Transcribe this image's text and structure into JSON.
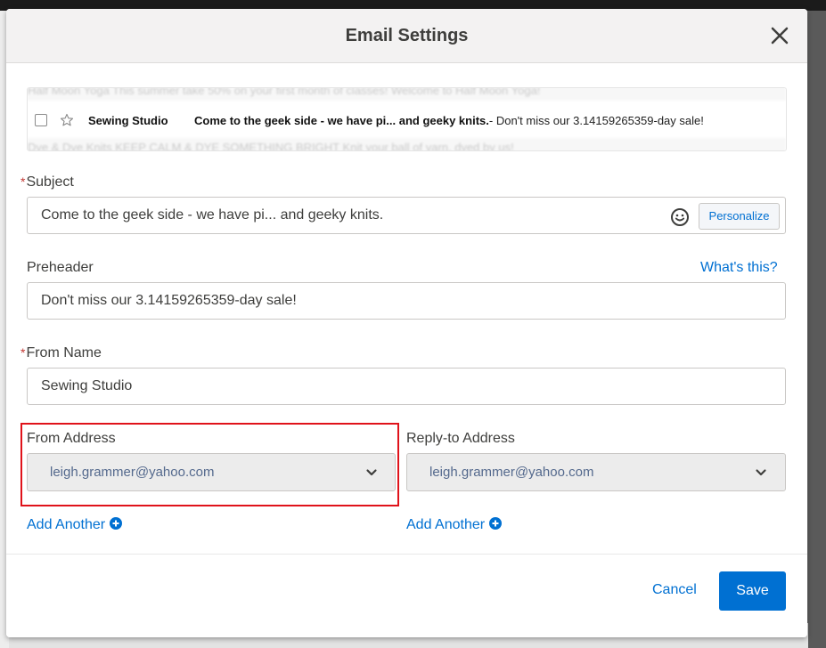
{
  "modal": {
    "title": "Email Settings"
  },
  "preview": {
    "ghost_top": "Half Moon Yoga     This summer take 50% on your first month of classes! Welcome to Half Moon Yoga!",
    "ghost_bottom": "Dye & Dye Knits     KEEP CALM & DYE SOMETHING BRIGHT     Knit your ball of yarn, dyed by us!",
    "sender": "Sewing Studio",
    "subject": "Come to the geek side - we have pi... and geeky knits.",
    "preheader": "- Don't miss our 3.14159265359-day sale!"
  },
  "form": {
    "required_mark": "*",
    "subject": {
      "label": "Subject",
      "value": "Come to the geek side - we have pi... and geeky knits.",
      "personalize_label": "Personalize"
    },
    "preheader": {
      "label": "Preheader",
      "help_link": "What's this?",
      "value": "Don't miss our 3.14159265359-day sale!"
    },
    "from_name": {
      "label": "From Name",
      "value": "Sewing Studio"
    },
    "from_address": {
      "label": "From Address",
      "value": "leigh.grammer@yahoo.com",
      "add_another": "Add Another"
    },
    "reply_to": {
      "label": "Reply-to Address",
      "value": "leigh.grammer@yahoo.com",
      "add_another": "Add Another"
    }
  },
  "footer": {
    "cancel_label": "Cancel",
    "save_label": "Save"
  },
  "colors": {
    "accent": "#0070d2",
    "required": "#c23934",
    "highlight": "#e0121a"
  }
}
